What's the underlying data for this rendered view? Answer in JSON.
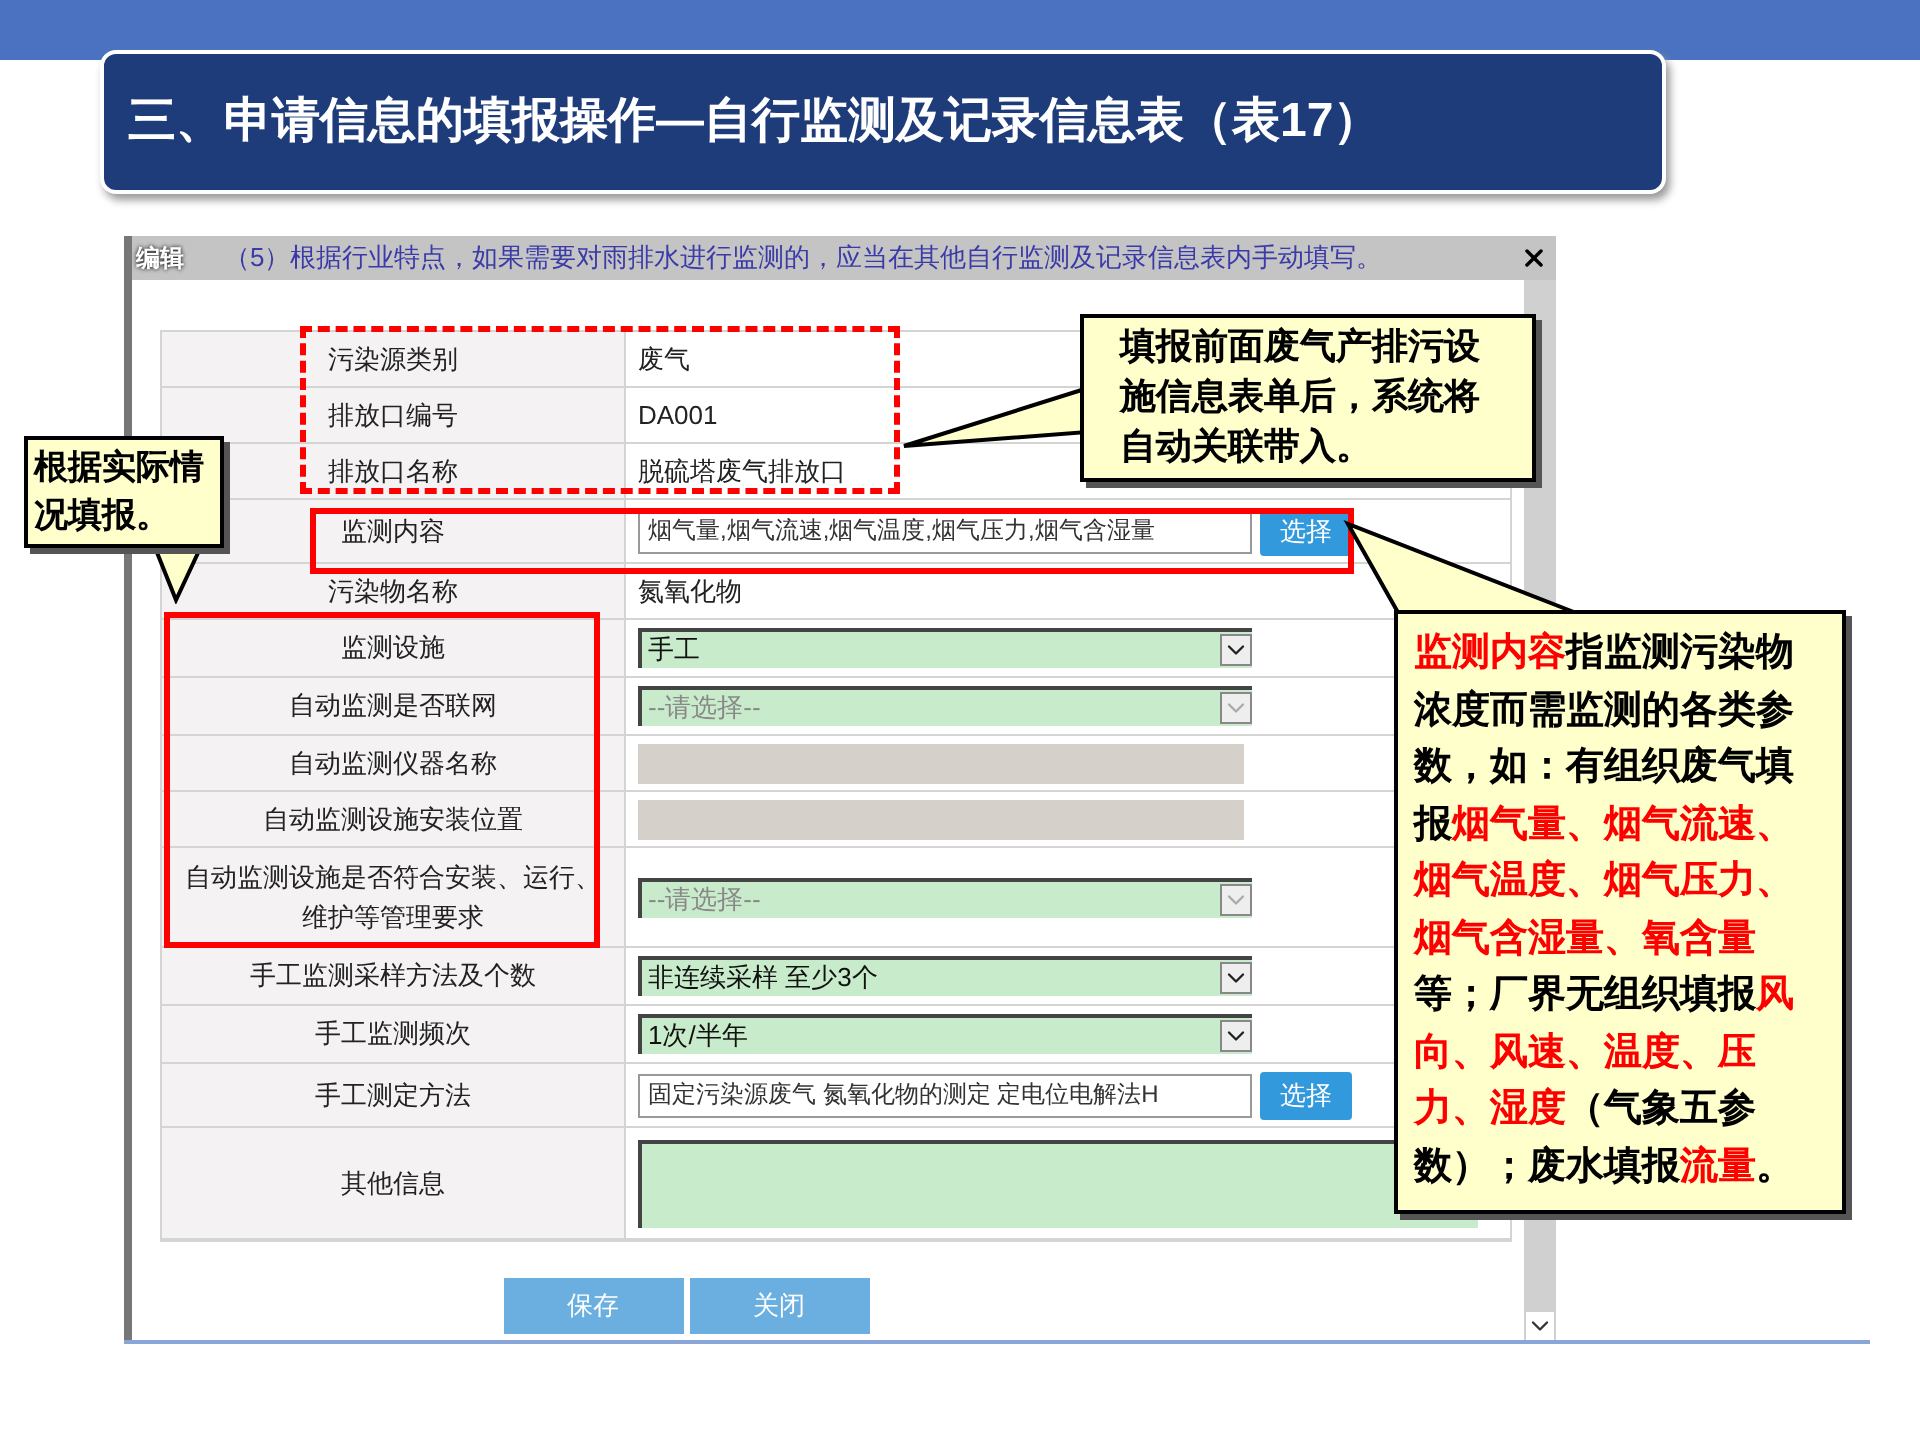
{
  "slide_title": "三、申请信息的填报操作—自行监测及记录信息表（表17）",
  "dialog": {
    "title": "编辑",
    "note": "（5）根据行业特点，如果需要对雨排水进行监测的，应当在其他自行监测及记录信息表内手动填写。",
    "fields": [
      {
        "label": "污染源类别",
        "kind": "text",
        "value": "废气"
      },
      {
        "label": "排放口编号",
        "kind": "text",
        "value": "DA001"
      },
      {
        "label": "排放口名称",
        "kind": "text",
        "value": "脱硫塔废气排放口"
      },
      {
        "label": "监测内容",
        "kind": "picker",
        "value": "烟气量,烟气流速,烟气温度,烟气压力,烟气含湿量",
        "button": "选择"
      },
      {
        "label": "污染物名称",
        "kind": "text",
        "value": "氮氧化物"
      },
      {
        "label": "监测设施",
        "kind": "select",
        "value": "手工",
        "disabled": false
      },
      {
        "label": "自动监测是否联网",
        "kind": "select",
        "placeholder": "--请选择--",
        "disabled": true
      },
      {
        "label": "自动监测仪器名称",
        "kind": "blank"
      },
      {
        "label": "自动监测设施安装位置",
        "kind": "blank"
      },
      {
        "label": "自动监测设施是否符合安装、运行、维护等管理要求",
        "kind": "select",
        "placeholder": "--请选择--",
        "disabled": true
      },
      {
        "label": "手工监测采样方法及个数",
        "kind": "select",
        "value": "非连续采样 至少3个",
        "disabled": false
      },
      {
        "label": "手工监测频次",
        "kind": "select",
        "value": "1次/半年",
        "disabled": false
      },
      {
        "label": "手工测定方法",
        "kind": "picker",
        "value": "固定污染源废气 氮氧化物的测定 定电位电解法H",
        "button": "选择"
      },
      {
        "label": "其他信息",
        "kind": "textarea"
      }
    ],
    "buttons": [
      "保存",
      "关闭"
    ]
  },
  "callouts": [
    {
      "segments": [
        {
          "text": "根据实际情况填报。",
          "highlight": false
        }
      ]
    },
    {
      "segments": [
        {
          "text": "填报前面废气产排污设施信息表单后，系统将自动关联带入。",
          "highlight": false
        }
      ]
    },
    {
      "segments": [
        {
          "text": "监测内容",
          "highlight": true
        },
        {
          "text": "指监测污染物浓度而需监测的各类参数，如：有组织废气填报",
          "highlight": false
        },
        {
          "text": "烟气量、烟气流速、烟气温度、烟气压力、烟气含湿量、氧含量",
          "highlight": true
        },
        {
          "text": "等；厂界无组织填报",
          "highlight": false
        },
        {
          "text": "风向、风速、温度、压力、湿度",
          "highlight": true
        },
        {
          "text": "（气象五参数）；废水填报",
          "highlight": false
        },
        {
          "text": "流量",
          "highlight": true
        },
        {
          "text": "。",
          "highlight": false
        }
      ]
    }
  ]
}
